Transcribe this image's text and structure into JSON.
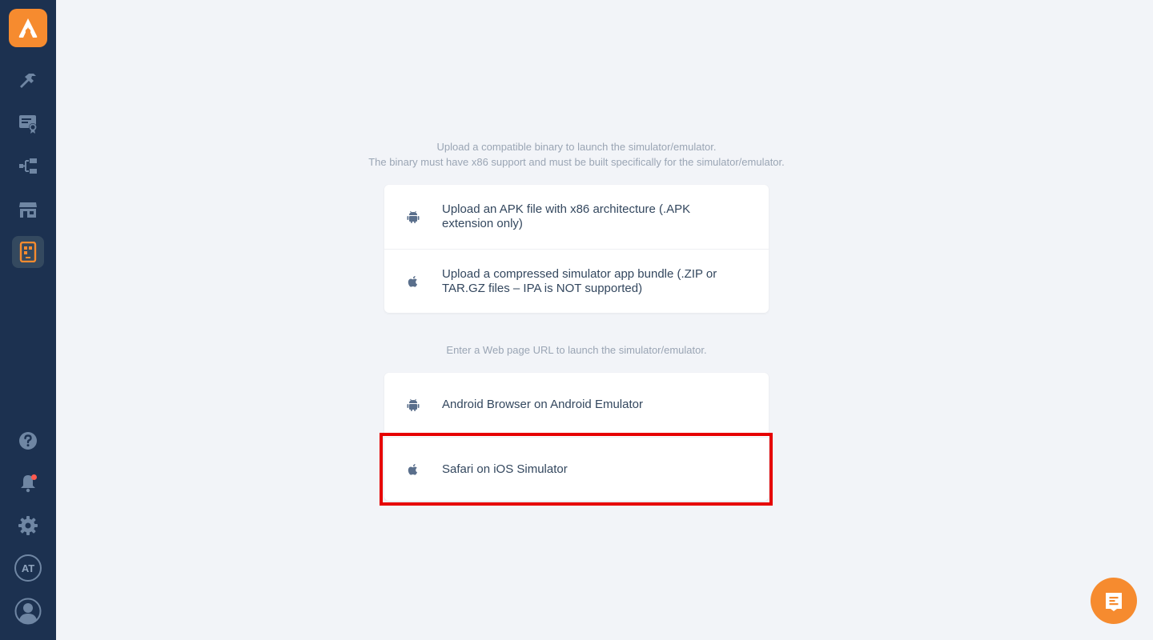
{
  "sidebar": {
    "logo": "app-logo",
    "nav": [
      {
        "name": "build-icon",
        "label": "Build"
      },
      {
        "name": "certificate-icon",
        "label": "Certificates"
      },
      {
        "name": "workflow-icon",
        "label": "Workflows"
      },
      {
        "name": "store-icon",
        "label": "Stores"
      },
      {
        "name": "simulator-icon",
        "label": "Simulator",
        "active": true
      }
    ],
    "bottom": {
      "help": "help-icon",
      "notifications": "bell-icon",
      "settings": "gear-icon",
      "initials": "AT",
      "profile": "user-icon"
    }
  },
  "binary_section": {
    "intro_line1": "Upload a compatible binary to launch the simulator/emulator.",
    "intro_line2": "The binary must have x86 support and must be built specifically for the simulator/emulator.",
    "options": [
      {
        "icon": "android-icon",
        "label": "Upload an APK file with x86 architecture (.APK extension only)"
      },
      {
        "icon": "apple-icon",
        "label": "Upload a compressed simulator app bundle (.ZIP or TAR.GZ files – IPA is NOT supported)"
      }
    ]
  },
  "url_section": {
    "intro": "Enter a Web page URL to launch the simulator/emulator.",
    "options": [
      {
        "icon": "android-icon",
        "label": "Android Browser on Android Emulator"
      },
      {
        "icon": "apple-icon",
        "label": "Safari on iOS Simulator",
        "highlighted": true
      }
    ]
  },
  "colors": {
    "sidebar": "#1c3150",
    "accent": "#f68b2f",
    "highlight": "#e60000",
    "background": "#f2f4f8"
  },
  "chat": {
    "icon": "chat-icon"
  }
}
